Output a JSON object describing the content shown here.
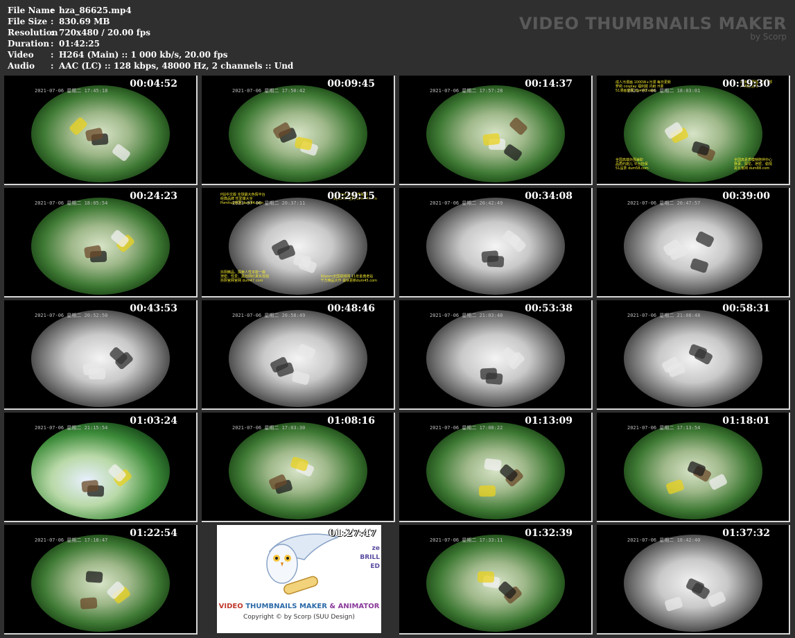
{
  "meta": [
    {
      "key": "File Name",
      "value": "hza_86625.mp4"
    },
    {
      "key": "File Size",
      "value": "830.69 MB"
    },
    {
      "key": "Resolution",
      "value": "720x480 / 20.00 fps"
    },
    {
      "key": "Duration",
      "value": "01:42:25"
    },
    {
      "key": "Video",
      "value": "H264 (Main) :: 1 000 kb/s, 20.00 fps"
    },
    {
      "key": "Audio",
      "value": "AAC (LC) :: 128 kbps, 48000 Hz, 2 channels :: Und"
    }
  ],
  "meta_separator": ":",
  "brand": {
    "title": "VIDEO THUMBNAILS MAKER",
    "subtitle": "by Scorp"
  },
  "colors": {
    "background": "#2f2f2f",
    "frame_border": "#d8d8d8",
    "timestamp": "#ffffff",
    "brand_text": "#595959"
  },
  "thumbnails": [
    {
      "timestamp": "00:04:52",
      "osd": "2021-07-06 星期二 17:45:18",
      "tone": "green"
    },
    {
      "timestamp": "00:09:45",
      "osd": "2021-07-06 星期二 17:50:42",
      "tone": "green"
    },
    {
      "timestamp": "00:14:37",
      "osd": "2021-07-06 星期二 17:57:28",
      "tone": "green"
    },
    {
      "timestamp": "00:19:30",
      "osd": "2021-07-06 星期二 18:03:01",
      "tone": "green",
      "ad": true
    },
    {
      "timestamp": "00:24:23",
      "osd": "2021-07-06 星期二 18:05:54",
      "tone": "green"
    },
    {
      "timestamp": "00:29:15",
      "osd": "2021-07-06 星期二 20:37:11",
      "tone": "gray",
      "ad": true
    },
    {
      "timestamp": "00:34:08",
      "osd": "2021-07-06 星期二 20:42:49",
      "tone": "gray"
    },
    {
      "timestamp": "00:39:00",
      "osd": "2021-07-06 星期二 20:47:57",
      "tone": "gray"
    },
    {
      "timestamp": "00:43:53",
      "osd": "2021-07-06 星期二 20:52:50",
      "tone": "gray"
    },
    {
      "timestamp": "00:48:46",
      "osd": "2021-07-06 星期二 20:58:49",
      "tone": "gray"
    },
    {
      "timestamp": "00:53:38",
      "osd": "2021-07-06 星期二 21:03:48",
      "tone": "gray"
    },
    {
      "timestamp": "00:58:31",
      "osd": "2021-07-06 星期二 21:08:48",
      "tone": "gray"
    },
    {
      "timestamp": "01:03:24",
      "osd": "2021-07-06 星期二 21:15:54",
      "tone": "mixed"
    },
    {
      "timestamp": "01:08:16",
      "osd": "2021-07-06 星期二 17:03:30",
      "tone": "green"
    },
    {
      "timestamp": "01:13:09",
      "osd": "2021-07-06 星期二 17:08:22",
      "tone": "green"
    },
    {
      "timestamp": "01:18:01",
      "osd": "2021-07-06 星期二 17:13:54",
      "tone": "green"
    },
    {
      "timestamp": "01:22:54",
      "osd": "2021-07-06 星期二 17:18:47",
      "tone": "green"
    },
    {
      "timestamp": "01:27:47",
      "osd": "",
      "tone": "card"
    },
    {
      "timestamp": "01:32:39",
      "osd": "2021-07-06 星期二 17:33:11",
      "tone": "green"
    },
    {
      "timestamp": "01:37:32",
      "osd": "2021-07-06 星期二 18:42:40",
      "tone": "gray"
    }
  ],
  "ad_text_1": {
    "tl": [
      "成人污漫画 1000W+污漫 每日更新",
      "萝莉 cosplay 福利姬 内射 H漫",
      "51漫画官网 dum49.com"
    ],
    "tr": [
      "Ai换脸 明星 1000部",
      "Ai换脸官网"
    ],
    "bl": [
      "全国高端外围兼职",
      "品质约炮儿 平台担保",
      "51品茶 dum58.com"
    ],
    "br": [
      "全国高素质模特陪伴中心",
      "换妻、探花、泄密、偷情",
      "黑化官网 dum88.com"
    ]
  },
  "ad_text_2": {
    "tl": [
      "P站中文版 全球最大色情平台",
      "经典品牌 性爱爆大全",
      "Pornhub官网 dum44.com"
    ],
    "tr": [
      "91Pron 原创国产视频",
      "网红MAX官网 dum45.com"
    ],
    "bl": [
      "抖阴精品、探索人性本能一最",
      "泄密、性爱、黑丝网红真实自拍",
      "抖阴官网官网 dum47.com"
    ],
    "br": [
      "91porn全国视频网 11年金典老站",
      "千万精品大作 最快更新dum45.com"
    ]
  },
  "card": {
    "title_a": "VIDEO",
    "title_b": "THUMBNAILS MAKER",
    "title_c": "& ANIMATOR",
    "copyright": "Copyright © by Scorp (SUU Design)",
    "side_a": "ze",
    "side_b": "BRILL",
    "side_c": "ED"
  }
}
